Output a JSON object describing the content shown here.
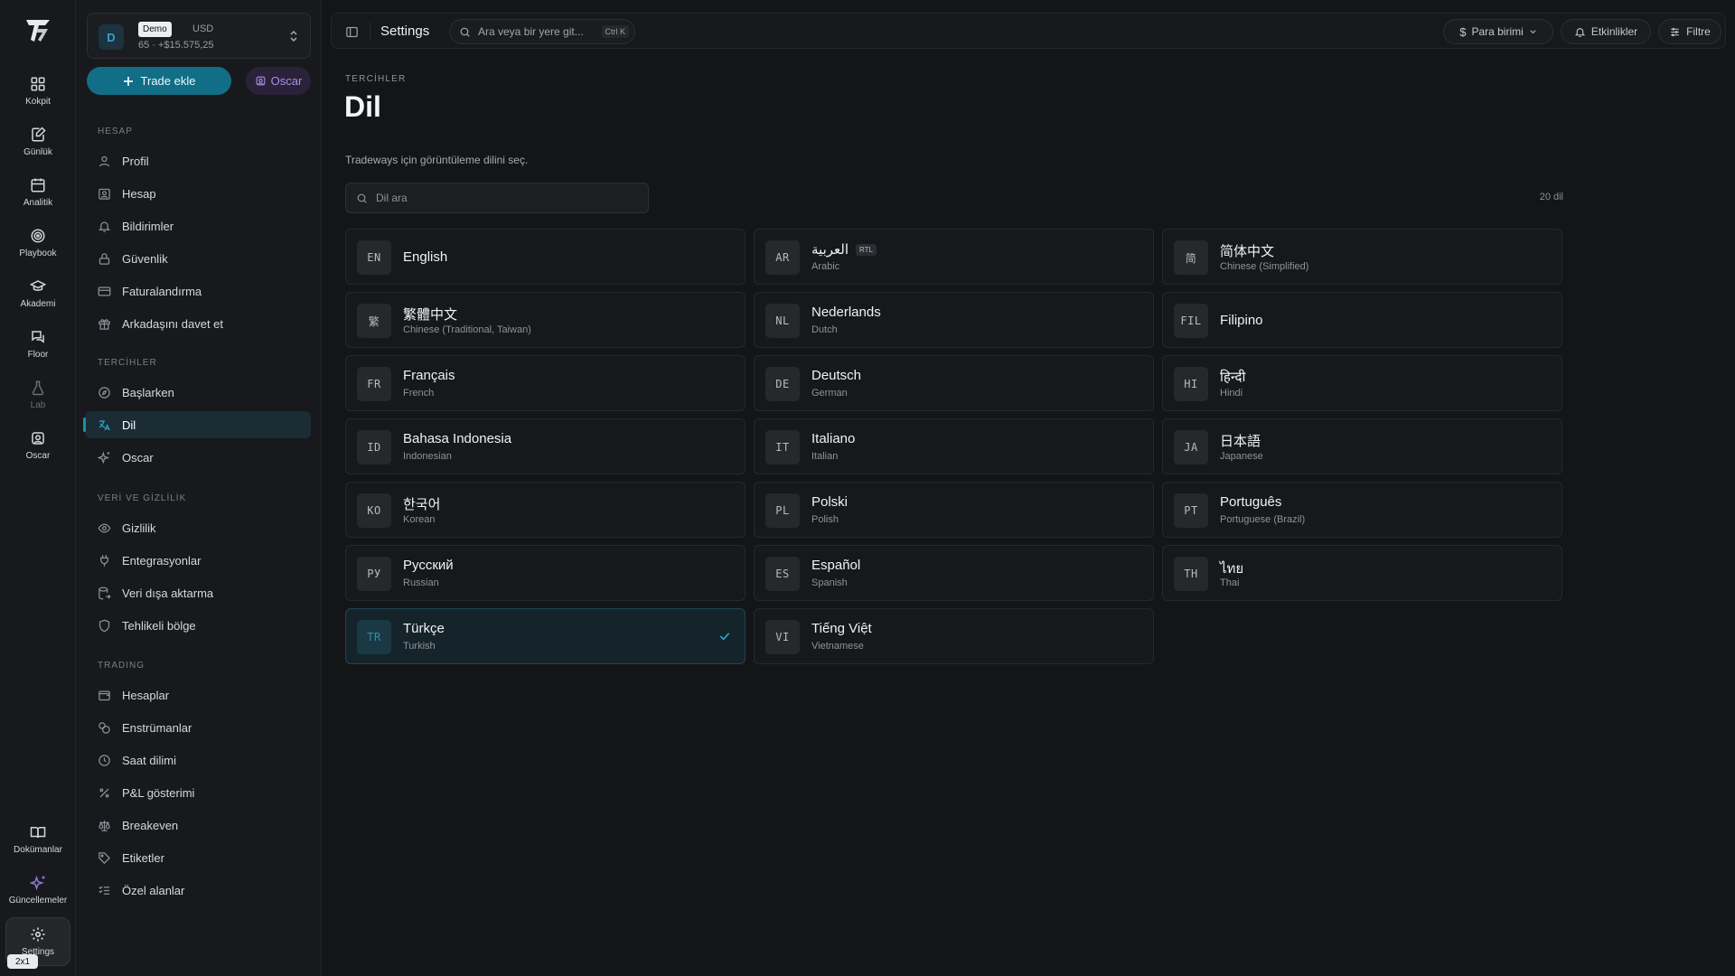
{
  "rail": {
    "items": [
      {
        "label": "Kokpit",
        "icon": "grid-icon"
      },
      {
        "label": "Günlük",
        "icon": "journal-icon"
      },
      {
        "label": "Analitik",
        "icon": "calendar-icon"
      },
      {
        "label": "Playbook",
        "icon": "target-icon"
      },
      {
        "label": "Akademi",
        "icon": "graduation-cap-icon"
      },
      {
        "label": "Floor",
        "icon": "chat-icon"
      },
      {
        "label": "Lab",
        "icon": "flask-icon"
      },
      {
        "label": "Oscar",
        "icon": "oscar-icon"
      }
    ],
    "bottom": [
      {
        "label": "Dokümanlar",
        "icon": "book-icon"
      },
      {
        "label": "Güncellemeler",
        "icon": "sparkle-icon"
      },
      {
        "label": "Settings",
        "icon": "gear-icon"
      }
    ],
    "badge": "2x1"
  },
  "account": {
    "avatar": "D",
    "tag": "Demo",
    "currency": "USD",
    "sub": "65 · +$15.575,25"
  },
  "actions": {
    "trade": "Trade ekle",
    "oscar": "Oscar"
  },
  "sidebar": {
    "sections": [
      {
        "title": "HESAP",
        "items": [
          "Profil",
          "Hesap",
          "Bildirimler",
          "Güvenlik",
          "Faturalandırma",
          "Arkadaşını davet et"
        ]
      },
      {
        "title": "TERCİHLER",
        "items": [
          "Başlarken",
          "Dil",
          "Oscar"
        ]
      },
      {
        "title": "VERİ VE GİZLİLİK",
        "items": [
          "Gizlilik",
          "Entegrasyonlar",
          "Veri dışa aktarma",
          "Tehlikeli bölge"
        ]
      },
      {
        "title": "TRADING",
        "items": [
          "Hesaplar",
          "Enstrümanlar",
          "Saat dilimi",
          "P&L gösterimi",
          "Breakeven",
          "Etiketler",
          "Özel alanlar"
        ]
      }
    ],
    "active": "Dil"
  },
  "topbar": {
    "title": "Settings",
    "search_placeholder": "Ara veya bir yere git...",
    "shortcut": "Ctrl K",
    "currency": "Para birimi",
    "events": "Etkinlikler",
    "filter": "Filtre"
  },
  "page": {
    "eyebrow": "TERCİHLER",
    "title": "Dil",
    "description": "Tradeways için görüntüleme dilini seç.",
    "search_placeholder": "Dil ara",
    "count": "20 dil"
  },
  "languages": [
    {
      "code": "EN",
      "native": "English",
      "english": ""
    },
    {
      "code": "AR",
      "native": "العربية",
      "english": "Arabic",
      "rtl": "RTL"
    },
    {
      "code": "简",
      "native": "简体中文",
      "english": "Chinese (Simplified)"
    },
    {
      "code": "繁",
      "native": "繁體中文",
      "english": "Chinese (Traditional, Taiwan)"
    },
    {
      "code": "NL",
      "native": "Nederlands",
      "english": "Dutch"
    },
    {
      "code": "FIL",
      "native": "Filipino",
      "english": ""
    },
    {
      "code": "FR",
      "native": "Français",
      "english": "French"
    },
    {
      "code": "DE",
      "native": "Deutsch",
      "english": "German"
    },
    {
      "code": "HI",
      "native": "हिन्दी",
      "english": "Hindi"
    },
    {
      "code": "ID",
      "native": "Bahasa Indonesia",
      "english": "Indonesian"
    },
    {
      "code": "IT",
      "native": "Italiano",
      "english": "Italian"
    },
    {
      "code": "JA",
      "native": "日本語",
      "english": "Japanese"
    },
    {
      "code": "KO",
      "native": "한국어",
      "english": "Korean"
    },
    {
      "code": "PL",
      "native": "Polski",
      "english": "Polish"
    },
    {
      "code": "PT",
      "native": "Português",
      "english": "Portuguese (Brazil)"
    },
    {
      "code": "РУ",
      "native": "Русский",
      "english": "Russian"
    },
    {
      "code": "ES",
      "native": "Español",
      "english": "Spanish"
    },
    {
      "code": "TH",
      "native": "ไทย",
      "english": "Thai"
    },
    {
      "code": "TR",
      "native": "Türkçe",
      "english": "Turkish",
      "selected": true
    },
    {
      "code": "VI",
      "native": "Tiếng Việt",
      "english": "Vietnamese"
    }
  ],
  "colors": {
    "accent": "#126e86",
    "accent_text": "#2aa6c8",
    "oscar": "#a98ee8",
    "background": "#141517"
  }
}
